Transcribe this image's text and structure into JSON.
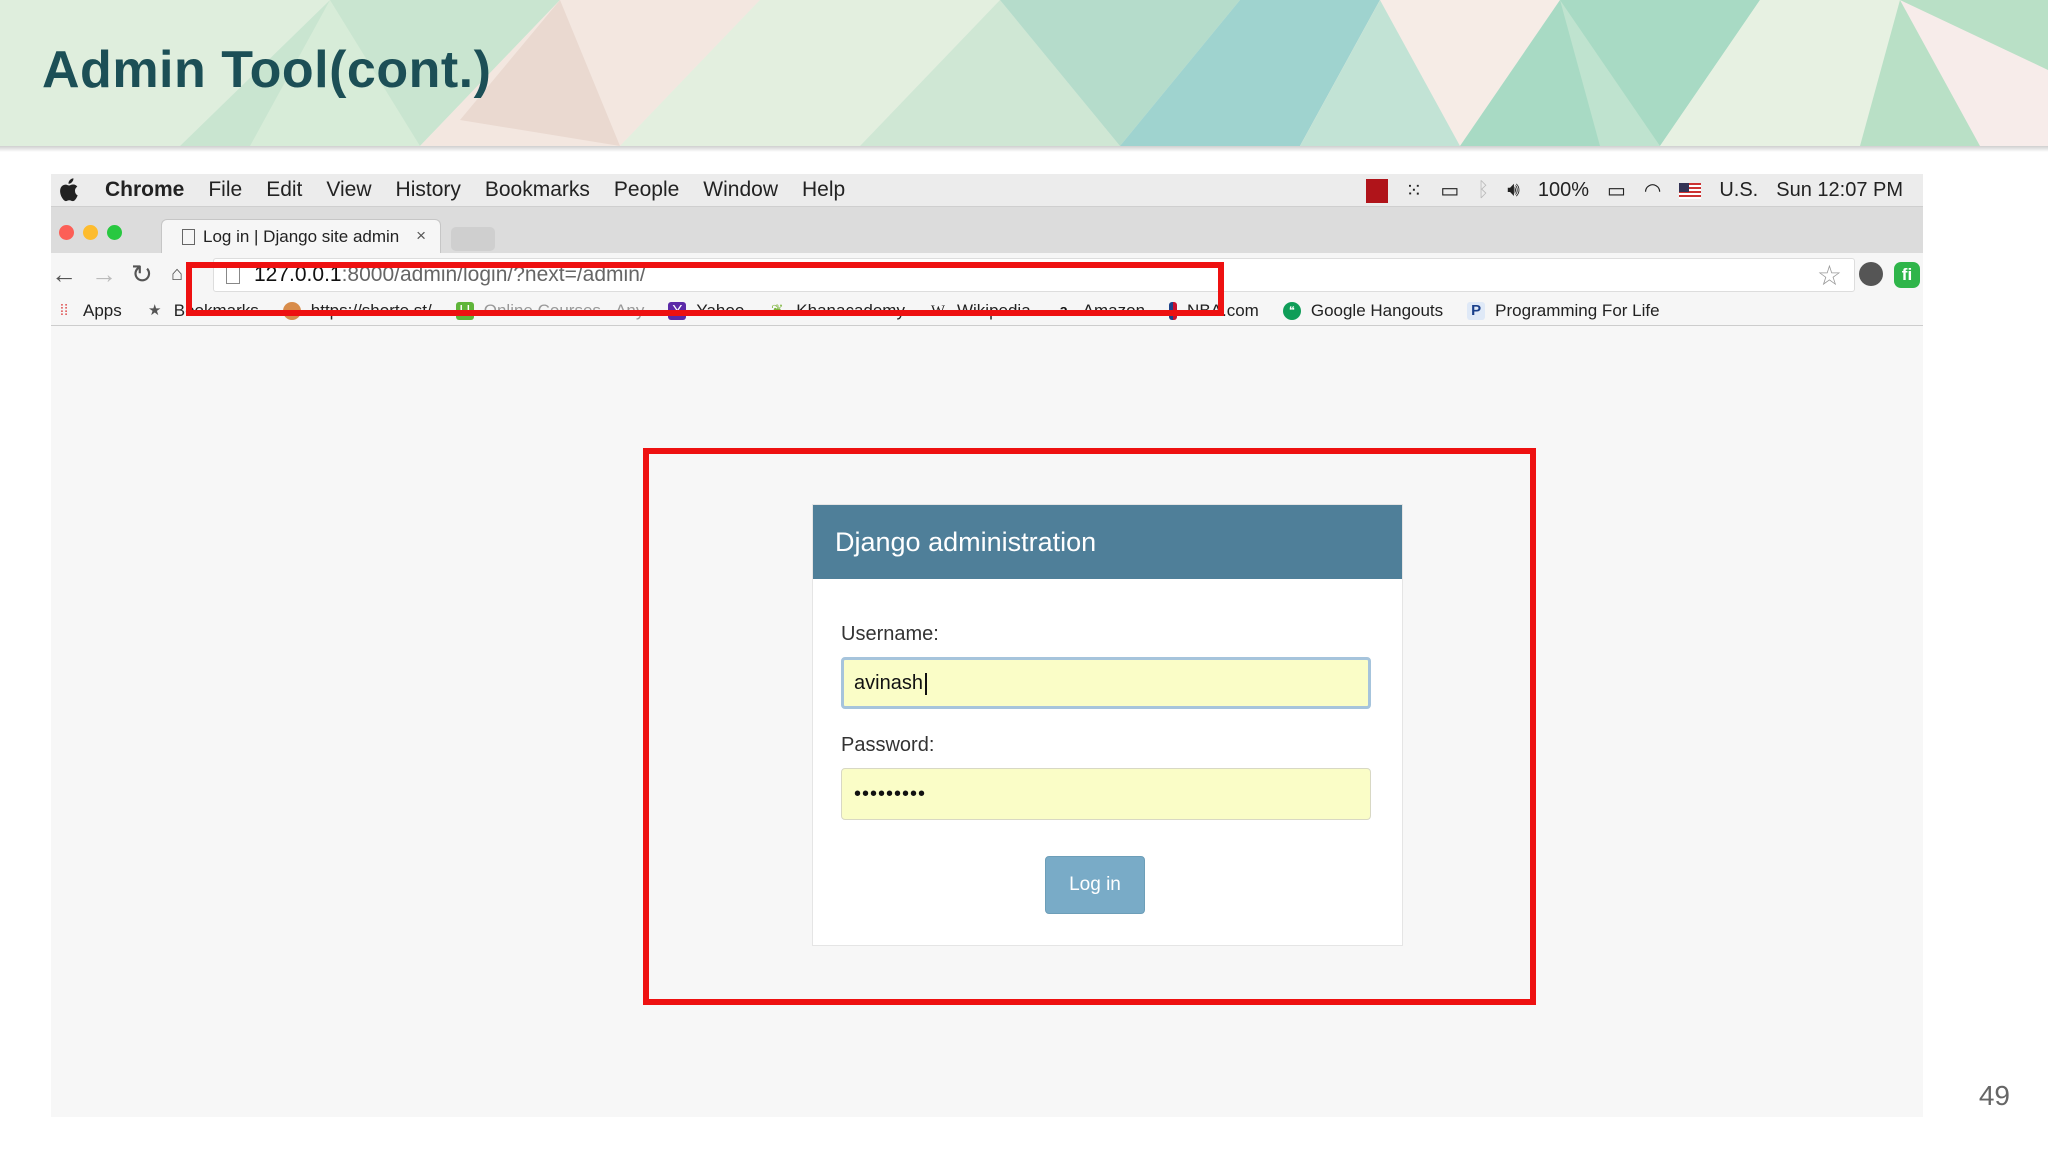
{
  "slide": {
    "title": "Admin Tool(cont.)",
    "page_number": "49"
  },
  "menubar": {
    "app_name": "Chrome",
    "menus": [
      "File",
      "Edit",
      "View",
      "History",
      "Bookmarks",
      "People",
      "Window",
      "Help"
    ],
    "battery": "100%",
    "input_source": "U.S.",
    "clock": "Sun 12:07 PM"
  },
  "tab": {
    "title": "Log in | Django site admin",
    "close": "×"
  },
  "omnibox": {
    "url_host": "127.0.0.1",
    "url_path": ":8000/admin/login/?next=/admin/"
  },
  "bookmarks": [
    {
      "label": "Apps",
      "icon": "apps-grid-icon"
    },
    {
      "label": "Bookmarks",
      "icon": "star-icon"
    },
    {
      "label": "https://shorte.st/",
      "icon": "shortest-icon"
    },
    {
      "label": "Online Courses - Any",
      "icon": "udemy-icon"
    },
    {
      "label": "Yahoo",
      "icon": "yahoo-icon"
    },
    {
      "label": "Khanacademy",
      "icon": "leaf-icon"
    },
    {
      "label": "Wikipedia",
      "icon": "wikipedia-icon"
    },
    {
      "label": "Amazon",
      "icon": "amazon-icon"
    },
    {
      "label": "NBA.com",
      "icon": "nba-icon"
    },
    {
      "label": "Google Hangouts",
      "icon": "hangouts-icon"
    },
    {
      "label": "Programming For Life",
      "icon": "p-icon"
    }
  ],
  "login": {
    "header": "Django administration",
    "username_label": "Username:",
    "username_value": "avinash",
    "password_label": "Password:",
    "password_value": "•••••••••",
    "button_label": "Log in"
  },
  "colors": {
    "slide_title": "#1c4f56",
    "login_header": "#4f7f99",
    "login_button": "#79abc7",
    "field_fill": "#fafdc7",
    "highlight": "#ee1111"
  }
}
